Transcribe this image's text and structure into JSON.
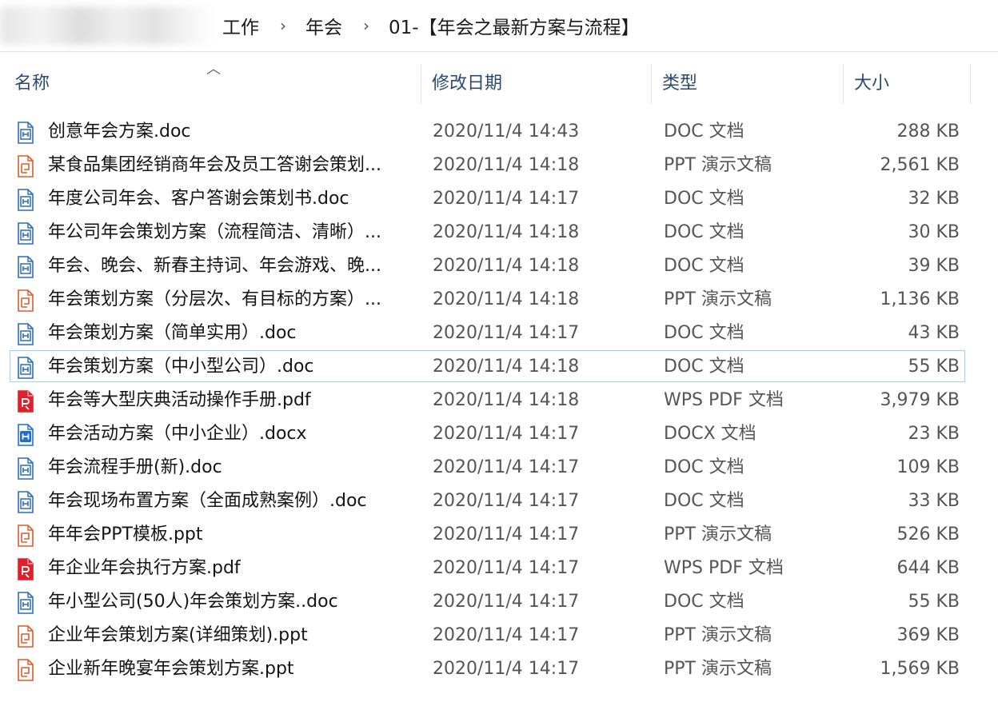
{
  "breadcrumb": [
    "工作",
    "年会",
    "01-【年会之最新方案与流程】"
  ],
  "columns": {
    "name": "名称",
    "modified": "修改日期",
    "type": "类型",
    "size": "大小"
  },
  "files": [
    {
      "icon": "doc-icon",
      "name": "创意年会方案.doc",
      "modified": "2020/11/4 14:43",
      "type": "DOC 文档",
      "size": "288 KB"
    },
    {
      "icon": "ppt-icon",
      "name": "某食品集团经销商年会及员工答谢会策划...",
      "modified": "2020/11/4 14:18",
      "type": "PPT 演示文稿",
      "size": "2,561 KB"
    },
    {
      "icon": "doc-icon",
      "name": "年度公司年会、客户答谢会策划书.doc",
      "modified": "2020/11/4 14:17",
      "type": "DOC 文档",
      "size": "32 KB"
    },
    {
      "icon": "doc-icon",
      "name": "年公司年会策划方案（流程简洁、清晰）...",
      "modified": "2020/11/4 14:18",
      "type": "DOC 文档",
      "size": "30 KB"
    },
    {
      "icon": "doc-icon",
      "name": "年会、晚会、新春主持词、年会游戏、晚...",
      "modified": "2020/11/4 14:18",
      "type": "DOC 文档",
      "size": "39 KB"
    },
    {
      "icon": "ppt-icon",
      "name": "年会策划方案（分层次、有目标的方案）...",
      "modified": "2020/11/4 14:18",
      "type": "PPT 演示文稿",
      "size": "1,136 KB"
    },
    {
      "icon": "doc-icon",
      "name": "年会策划方案（简单实用）.doc",
      "modified": "2020/11/4 14:17",
      "type": "DOC 文档",
      "size": "43 KB"
    },
    {
      "icon": "doc-icon",
      "name": "年会策划方案（中小型公司）.doc",
      "modified": "2020/11/4 14:18",
      "type": "DOC 文档",
      "size": "55 KB",
      "selected": true
    },
    {
      "icon": "pdf-icon",
      "name": "年会等大型庆典活动操作手册.pdf",
      "modified": "2020/11/4 14:18",
      "type": "WPS PDF 文档",
      "size": "3,979 KB"
    },
    {
      "icon": "docx-icon",
      "name": "年会活动方案（中小企业）.docx",
      "modified": "2020/11/4 14:17",
      "type": "DOCX 文档",
      "size": "23 KB"
    },
    {
      "icon": "doc-icon",
      "name": "年会流程手册(新).doc",
      "modified": "2020/11/4 14:17",
      "type": "DOC 文档",
      "size": "109 KB"
    },
    {
      "icon": "doc-icon",
      "name": "年会现场布置方案（全面成熟案例）.doc",
      "modified": "2020/11/4 14:17",
      "type": "DOC 文档",
      "size": "33 KB"
    },
    {
      "icon": "ppt-icon",
      "name": "年年会PPT模板.ppt",
      "modified": "2020/11/4 14:17",
      "type": "PPT 演示文稿",
      "size": "526 KB"
    },
    {
      "icon": "pdf-icon",
      "name": "年企业年会执行方案.pdf",
      "modified": "2020/11/4 14:17",
      "type": "WPS PDF 文档",
      "size": "644 KB"
    },
    {
      "icon": "doc-icon",
      "name": "年小型公司(50人)年会策划方案..doc",
      "modified": "2020/11/4 14:17",
      "type": "DOC 文档",
      "size": "55 KB"
    },
    {
      "icon": "ppt-icon",
      "name": "企业年会策划方案(详细策划).ppt",
      "modified": "2020/11/4 14:17",
      "type": "PPT 演示文稿",
      "size": "369 KB"
    },
    {
      "icon": "ppt-icon",
      "name": "企业新年晚宴年会策划方案.ppt",
      "modified": "2020/11/4 14:17",
      "type": "PPT 演示文稿",
      "size": "1,569 KB"
    }
  ],
  "colors": {
    "doc": "#2b6cc4",
    "ppt": "#e05a2b",
    "pdf": "#e0202a",
    "docx": "#1f6fd6",
    "header_text": "#2c4a6e",
    "selection_border": "#99d1ff"
  }
}
